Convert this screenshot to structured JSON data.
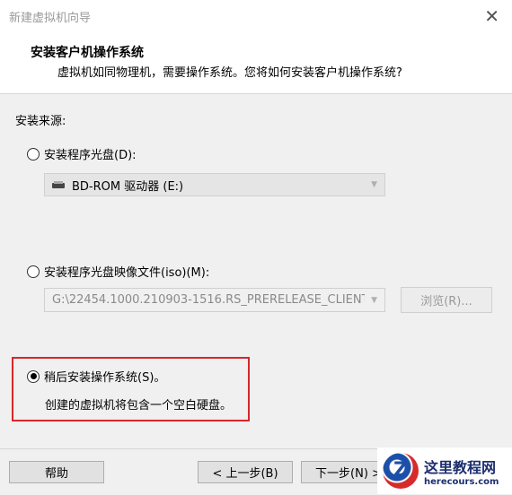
{
  "window": {
    "title": "新建虚拟机向导",
    "close_glyph": "✕"
  },
  "header": {
    "title": "安装客户机操作系统",
    "subtitle": "虚拟机如同物理机，需要操作系统。您将如何安装客户机操作系统?"
  },
  "source": {
    "label": "安装来源:",
    "disc": {
      "label": "安装程序光盘(D):",
      "selected": false,
      "drive_value": "BD-ROM 驱动器 (E:)"
    },
    "iso": {
      "label": "安装程序光盘映像文件(iso)(M):",
      "selected": false,
      "path_value": "G:\\22454.1000.210903-1516.RS_PRERELEASE_CLIENT",
      "browse_label": "浏览(R)..."
    },
    "later": {
      "label": "稍后安装操作系统(S)。",
      "selected": true,
      "description": "创建的虚拟机将包含一个空白硬盘。"
    }
  },
  "footer": {
    "help_label": "帮助",
    "back_label": "< 上一步(B)",
    "next_label": "下一步(N) >"
  },
  "watermark": {
    "name": "这里教程网",
    "url": "herecours.com"
  },
  "colors": {
    "highlight_border": "#d9262b"
  }
}
